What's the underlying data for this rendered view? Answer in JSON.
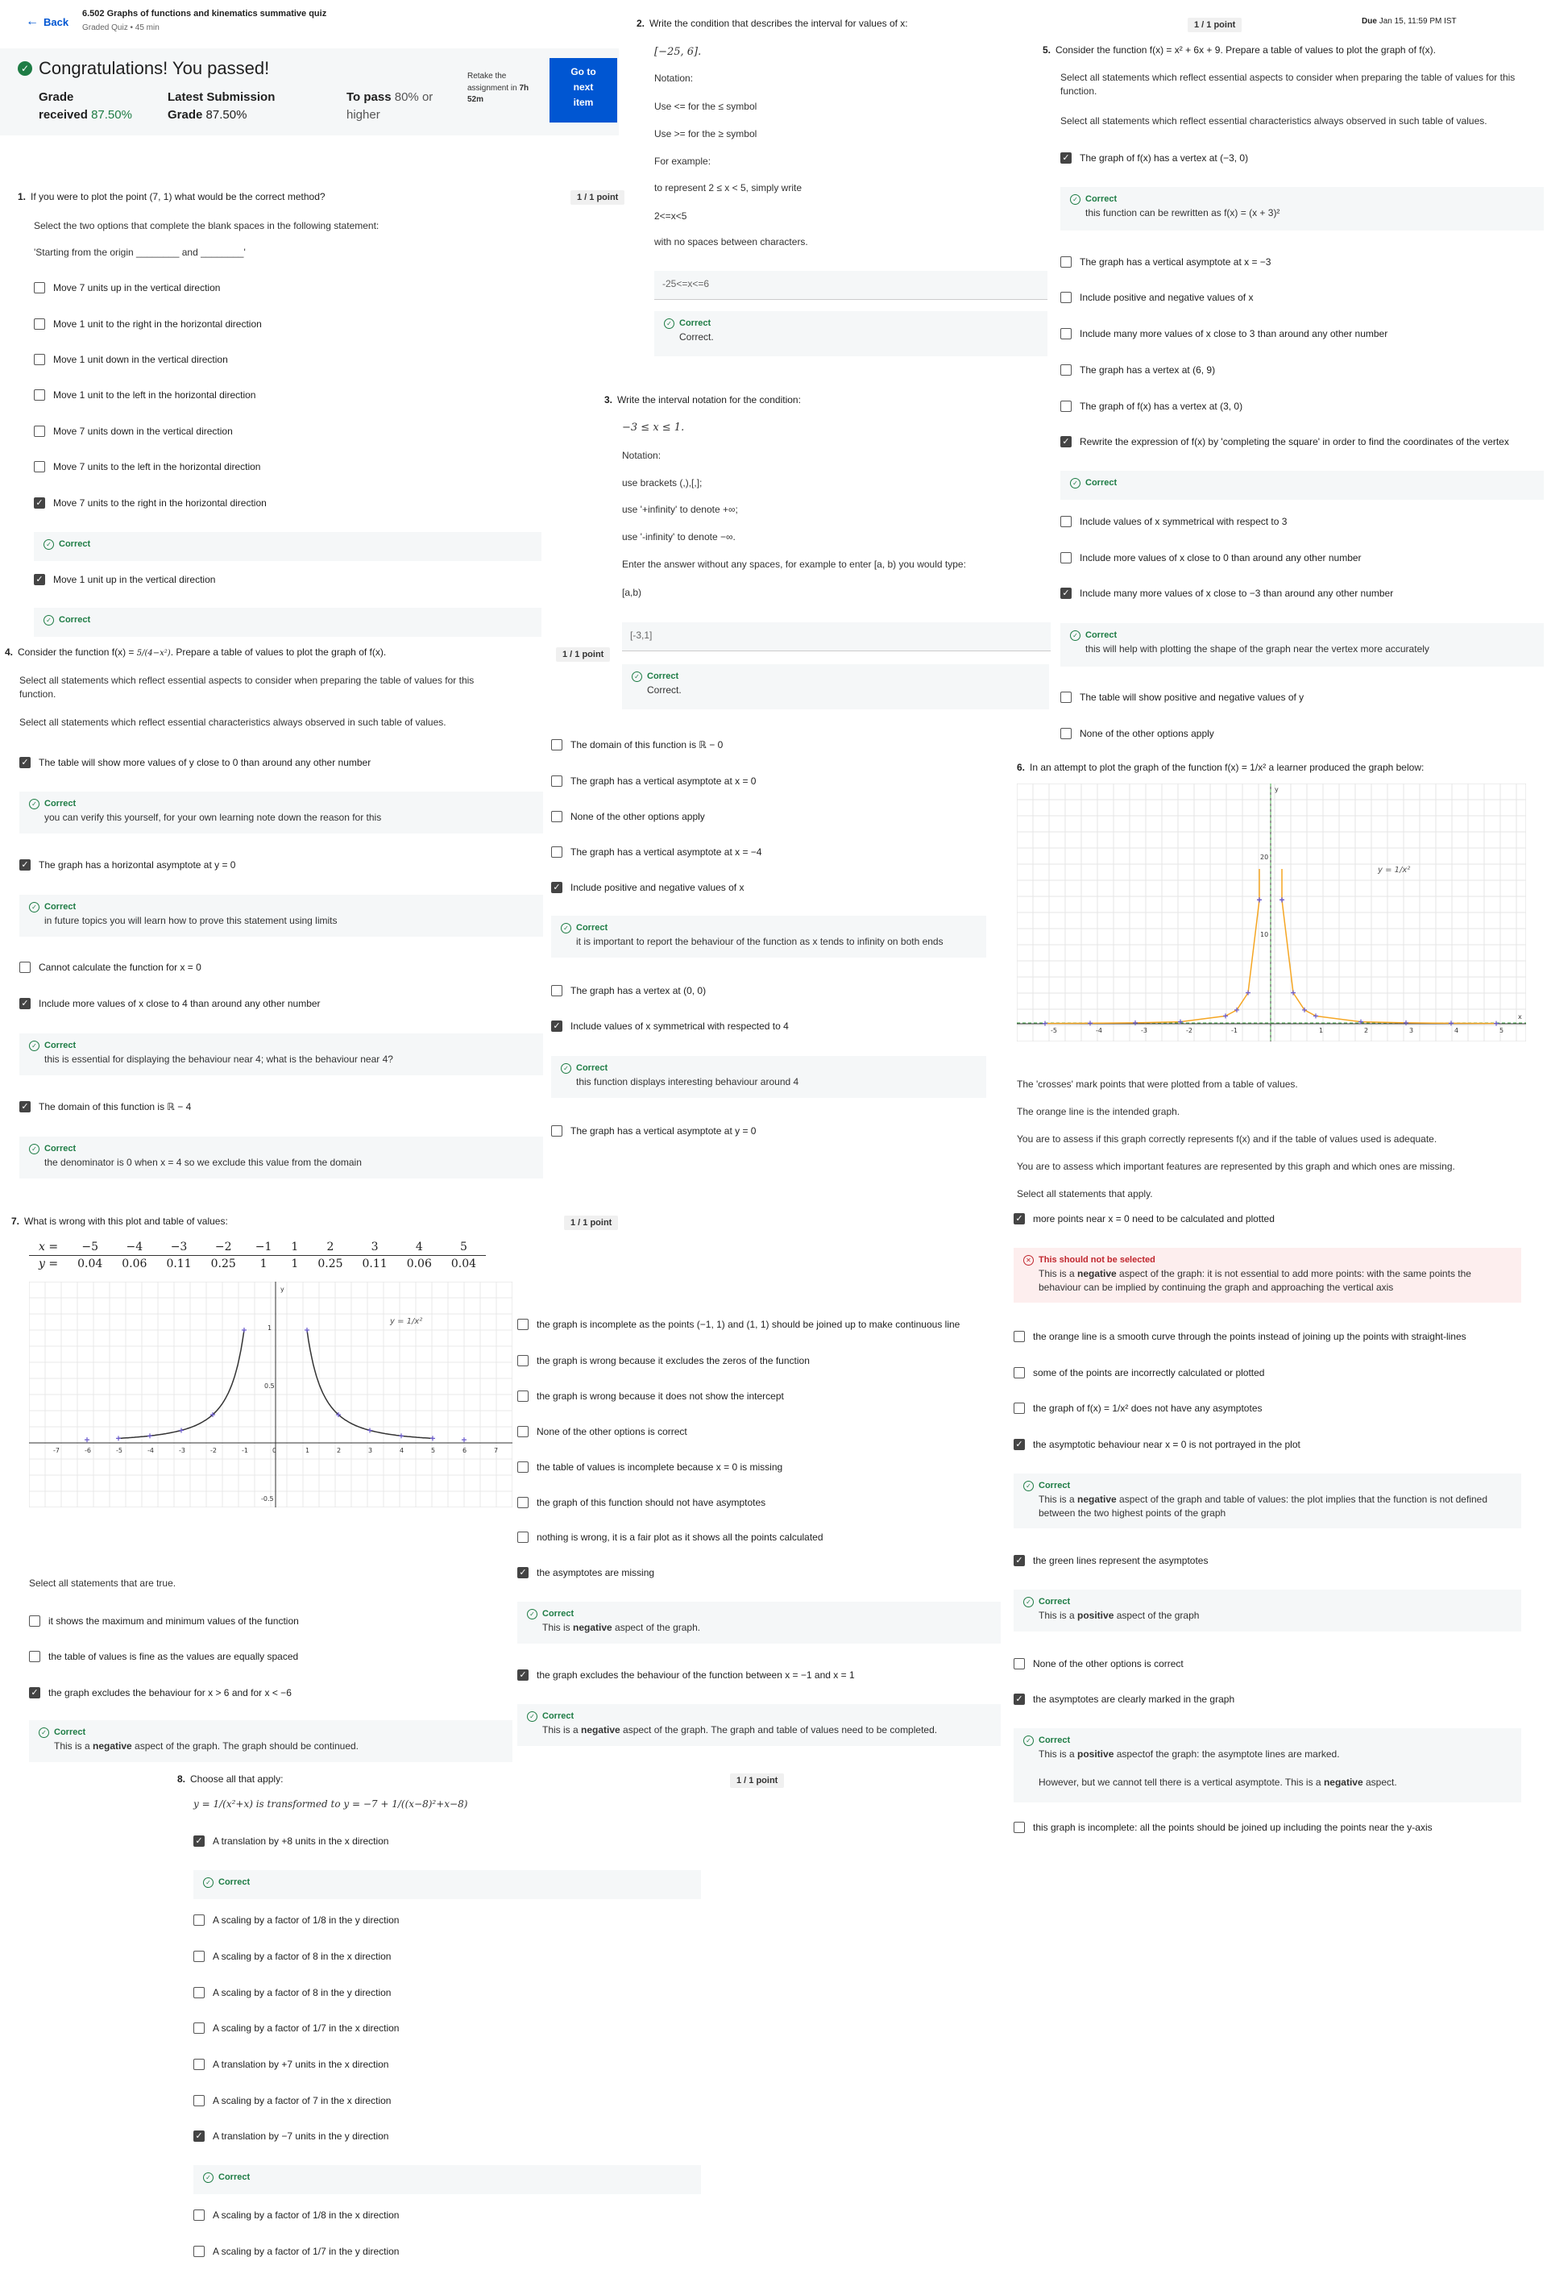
{
  "header": {
    "back": "Back",
    "title": "6.502 Graphs of functions and kinematics summative quiz",
    "subtitle": "Graded Quiz • 45 min",
    "due_label": "Due",
    "due_value": "Jan 15, 11:59 PM IST"
  },
  "result": {
    "congrats": "Congratulations! You passed!",
    "grade_label": "Grade",
    "grade_label2": "received",
    "grade_value": "87.50%",
    "latest_label": "Latest Submission",
    "latest_label2": "Grade",
    "latest_value": "87.50%",
    "pass_label": "To pass",
    "pass_value": "80% or",
    "pass_value2": "higher",
    "retake_1": "Retake the",
    "retake_2": "assignment in",
    "retake_bold": "7h",
    "retake_3": "52m",
    "next_1": "Go to",
    "next_2": "next",
    "next_3": "item"
  },
  "q1": {
    "num": "1.",
    "point": "1 / 1 point",
    "prompt": "If you were to plot the point (7, 1) what would be the correct method?",
    "line2": "Select the two options that complete the blank spaces in the following statement:",
    "line3": "'Starting from the origin ________ and ________'",
    "options": [
      {
        "label": "Move 7 units up in the vertical direction",
        "checked": false
      },
      {
        "label": "Move 1 unit to the right in the horizontal direction",
        "checked": false
      },
      {
        "label": "Move 1 unit down in the vertical direction",
        "checked": false
      },
      {
        "label": "Move 1 unit to the left in the horizontal direction",
        "checked": false
      },
      {
        "label": "Move 7 units down in the vertical direction",
        "checked": false
      },
      {
        "label": "Move 7 units to the left in the horizontal direction",
        "checked": false
      },
      {
        "label": "Move 7 units to the right in the horizontal direction",
        "checked": true
      },
      {
        "label": "Move 1 unit up in the vertical direction",
        "checked": true
      }
    ],
    "correct": "Correct"
  },
  "q2": {
    "num": "2.",
    "prompt": "Write the condition that describes the interval for values of x:",
    "interval": "[−25, 6].",
    "notation": "Notation:",
    "use1": "Use <= for the ≤ symbol",
    "use2": "Use >= for the ≥ symbol",
    "example": "For example:",
    "ex2": "to represent 2 ≤ x < 5, simply write",
    "ex3": "2<=x<5",
    "ex4": "with no spaces between characters.",
    "answer": "-25<=x<=6",
    "correct": "Correct",
    "correct_desc": "Correct."
  },
  "q3": {
    "num": "3.",
    "prompt": "Write the interval notation for the condition:",
    "cond": "−3 ≤ x ≤ 1.",
    "notation": "Notation:",
    "n1": "use brackets (,),[,];",
    "n2": "use '+infinity' to denote +∞;",
    "n3": "use '-infinity' to denote −∞.",
    "n4": "Enter the answer without any spaces, for example to enter [a, b) you would type:",
    "n5": "[a,b)",
    "answer": "[-3,1]",
    "correct": "Correct",
    "correct_desc": "Correct."
  },
  "q4": {
    "num": "4.",
    "point": "1 / 1 point",
    "prompt_a": "Consider the function f(x) = ",
    "prompt_b": ". Prepare a table of values to plot the graph of f(x).",
    "line2": "Select all statements which reflect essential aspects to consider when preparing the table of values for this function.",
    "line3": "Select all statements which reflect essential characteristics always observed in such table of values.",
    "left": [
      {
        "label": "The table will show more values of y close to 0 than around any other number",
        "checked": true
      },
      {
        "label": "The graph has a horizontal asymptote at y = 0",
        "checked": true
      },
      {
        "label": "Cannot calculate the function for x = 0",
        "checked": false
      },
      {
        "label": "Include more values of x close to 4 than around any other number",
        "checked": true
      },
      {
        "label": "The domain of this function is ℝ − 4",
        "checked": true
      }
    ],
    "left_fb": [
      "you can verify this yourself, for your own learning note down the reason for this",
      "in future topics you will learn how to prove this statement using limits",
      "this is essential for displaying the behaviour near 4; what is the behaviour near 4?",
      "the denominator is 0 when x = 4 so we exclude this value from the domain"
    ],
    "right": [
      {
        "label": "The domain of this function is ℝ − 0",
        "checked": false
      },
      {
        "label": "The graph has a vertical asymptote at x = 0",
        "checked": false
      },
      {
        "label": "None of the other options apply",
        "checked": false
      },
      {
        "label": "The graph has a vertical asymptote at x = −4",
        "checked": false
      },
      {
        "label": "Include positive and negative values of x",
        "checked": true
      },
      {
        "label": "The graph has a vertex at (0, 0)",
        "checked": false
      },
      {
        "label": "Include values of x symmetrical with respected to 4",
        "checked": true
      },
      {
        "label": "The graph has a vertical asymptote at y = 0",
        "checked": false
      }
    ],
    "right_fb": [
      "it is important to report the behaviour of the function as x tends to infinity on both ends",
      "this function displays interesting behaviour around 4"
    ],
    "correct": "Correct"
  },
  "q5": {
    "num": "5.",
    "point": "1 / 1 point",
    "prompt": "Consider the function f(x) = x² + 6x + 9. Prepare a table of values to plot the graph of f(x).",
    "line2": "Select all statements which reflect essential aspects to consider when preparing the table of values for this function.",
    "line3": "Select all statements which reflect essential characteristics always observed in such table of values.",
    "options": [
      {
        "label": "The graph of f(x) has a vertex at (−3, 0)",
        "checked": true
      },
      {
        "label": "The graph has a vertical asymptote at x = −3",
        "checked": false
      },
      {
        "label": "Include positive and negative values of x",
        "checked": false
      },
      {
        "label": "Include many more values of x close to 3 than around any other number",
        "checked": false
      },
      {
        "label": "The graph has a vertex at (6, 9)",
        "checked": false
      },
      {
        "label": "The graph of f(x) has a vertex at (3, 0)",
        "checked": false
      },
      {
        "label": "Rewrite the expression of f(x) by 'completing the square' in order to find the coordinates of the vertex",
        "checked": true
      },
      {
        "label": "Include values of x symmetrical with respect to 3",
        "checked": false
      },
      {
        "label": "Include more values of x close to 0 than around any other number",
        "checked": false
      },
      {
        "label": "Include many more values of x close to −3 than around any other number",
        "checked": true
      },
      {
        "label": "The table will show positive and negative values of y",
        "checked": false
      },
      {
        "label": "None of the other options apply",
        "checked": false
      }
    ],
    "fb1": "this function can be rewritten as f(x) = (x + 3)²",
    "fb3": "this will help with plotting the shape of the graph near the vertex more accurately",
    "correct": "Correct"
  },
  "q6": {
    "num": "6.",
    "prompt": "In an attempt to plot the graph of the function f(x) = 1/x² a learner produced the graph below:",
    "graph_label": "y = 1/x²",
    "p1": "The 'crosses' mark points that were plotted from a table of values.",
    "p2": "The orange line is the intended graph.",
    "p3": "You are to assess if this graph correctly represents f(x) and if the table of values used is adequate.",
    "p4": "You are to assess which important features are represented by this graph and which ones are missing.",
    "p5": "Select all statements that apply.",
    "options": [
      {
        "label": "more points near x = 0 need to be calculated and plotted",
        "checked": true
      },
      {
        "label": "the orange line is a smooth curve through the points instead of joining up the points with straight-lines",
        "checked": false
      },
      {
        "label": "some of the points are incorrectly calculated or plotted",
        "checked": false
      },
      {
        "label": "the graph of f(x) = 1/x² does not have any asymptotes",
        "checked": false
      },
      {
        "label": "the asymptotic behaviour near x = 0 is not portrayed in the plot",
        "checked": true
      },
      {
        "label": "the green lines represent the asymptotes",
        "checked": true
      },
      {
        "label": "None of the other options is correct",
        "checked": false
      },
      {
        "label": "the asymptotes are clearly marked in the graph",
        "checked": true
      },
      {
        "label": "this graph is incomplete: all the points should be joined up including the points near the y-axis",
        "checked": false
      }
    ],
    "bad_title": "This should not be selected",
    "bad_desc_a": "This is a ",
    "bad_desc_b": "negative",
    "bad_desc_c": " aspect of the graph: it is not essential to add more points: with the same points the behaviour can be implied by continuing the graph and approaching the vertical axis",
    "fb2_a": "This is a ",
    "fb2_b": "negative",
    "fb2_c": " aspect of the graph and table of values: the plot implies that the function is not defined between the two highest points of the graph",
    "fb3_a": "This is a ",
    "fb3_b": "positive",
    "fb3_c": " aspect of the graph",
    "fb4_a": "This is a ",
    "fb4_b": "positive",
    "fb4_c": " aspectof the graph: the asymptote lines are marked.",
    "fb4_d": "However, but we cannot tell there is a vertical asymptote. This is a ",
    "fb4_e": "negative",
    "fb4_f": " aspect.",
    "correct": "Correct"
  },
  "q7": {
    "num": "7.",
    "point": "1 / 1 point",
    "prompt": "What is wrong with this plot and table of values:",
    "x_row": [
      "x =",
      "−5",
      "−4",
      "−3",
      "−2",
      "−1",
      "1",
      "2",
      "3",
      "4",
      "5"
    ],
    "y_row": [
      "y =",
      "0.04",
      "0.06",
      "0.11",
      "0.25",
      "1",
      "1",
      "0.25",
      "0.11",
      "0.06",
      "0.04"
    ],
    "graph_label": "y = 1/x²",
    "select": "Select all statements that are true.",
    "left": [
      {
        "label": "it shows the maximum and minimum values of the function",
        "checked": false
      },
      {
        "label": "the table of values is fine as the values are equally spaced",
        "checked": false
      },
      {
        "label": "the graph excludes the behaviour for x > 6 and for x < −6",
        "checked": true
      }
    ],
    "left_fb_a": "This is a ",
    "left_fb_b": "negative",
    "left_fb_c": " aspect of the graph. The graph should be continued.",
    "right": [
      {
        "label": "the graph is incomplete as the points (−1, 1) and (1, 1) should be joined up to make continuous line",
        "checked": false
      },
      {
        "label": "the graph is wrong because it excludes the zeros of the function",
        "checked": false
      },
      {
        "label": "the graph is wrong because it does not show the intercept",
        "checked": false
      },
      {
        "label": "None of the other options is correct",
        "checked": false
      },
      {
        "label": "the table of values is incomplete because x = 0 is missing",
        "checked": false
      },
      {
        "label": "the graph of this function should not have asymptotes",
        "checked": false
      },
      {
        "label": "nothing is wrong, it is a fair plot as it shows all the points calculated",
        "checked": false
      },
      {
        "label": "the asymptotes are missing",
        "checked": true
      },
      {
        "label": "the graph excludes the behaviour of the function between x = −1 and x = 1",
        "checked": true
      }
    ],
    "rfb1_a": "This is ",
    "rfb1_b": "negative",
    "rfb1_c": " aspect of the graph.",
    "rfb2_a": "This is a ",
    "rfb2_b": "negative",
    "rfb2_c": " aspect of the graph. The graph and table of values need to be completed.",
    "correct": "Correct"
  },
  "q8": {
    "num": "8.",
    "point": "1 / 1 point",
    "prompt": "Choose all that apply:",
    "transform": "y = 1/(x²+x) is transformed to y = −7 + 1/((x−8)²+x−8)",
    "options": [
      {
        "label": "A translation by +8 units in the x direction",
        "checked": true
      },
      {
        "label": "A scaling by a factor of 1/8 in the y direction",
        "checked": false
      },
      {
        "label": "A scaling by a factor of 8 in the x direction",
        "checked": false
      },
      {
        "label": "A scaling by a factor of 8 in the y direction",
        "checked": false
      },
      {
        "label": "A scaling by a factor of 1/7 in the x direction",
        "checked": false
      },
      {
        "label": "A translation by +7 units in the x direction",
        "checked": false
      },
      {
        "label": "A scaling by a factor of 7 in the x direction",
        "checked": false
      },
      {
        "label": "A translation by −7 units in the y direction",
        "checked": true
      },
      {
        "label": "A scaling by a factor of 1/8 in the x direction",
        "checked": false
      },
      {
        "label": "A scaling by a factor of 1/7 in the y direction",
        "checked": false
      }
    ],
    "correct": "Correct"
  },
  "colors": {
    "accent": "#0056d2",
    "success": "#1e7c45",
    "error": "#c0262d",
    "curve_orange": "#f5a623",
    "cross_blue": "#6a5acd"
  }
}
